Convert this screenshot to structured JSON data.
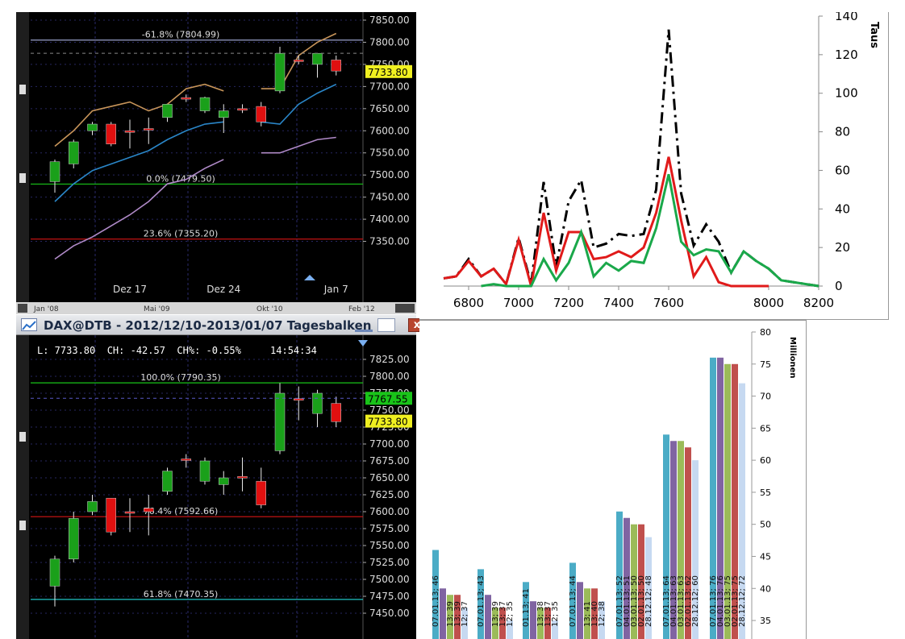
{
  "window": {
    "title": "DAX@DTB - 2012/12/10-2013/01/07 Tagesbalken",
    "close_label": "x",
    "info": {
      "last": "L: 7733.80",
      "change": "CH: -42.57",
      "change_pct": "CH%: -0.55%",
      "time": "14:54:34"
    }
  },
  "colors": {
    "up": "#1aa01a",
    "down": "#e01010",
    "bg": "#000000",
    "wick": "#e8e8e8"
  },
  "chart_data": [
    {
      "id": "dax-daily-top",
      "type": "candlestick",
      "ylim": [
        7300,
        7850
      ],
      "y_ticks": [
        7850,
        7800,
        7750,
        7700,
        7650,
        7600,
        7550,
        7500,
        7450,
        7400,
        7350
      ],
      "y_tick_labels": [
        "7850.00",
        "7800.00",
        "7750.00",
        "7700.00",
        "7650.00",
        "7600.00",
        "7550.00",
        "7500.00",
        "7450.00",
        "7400.00",
        "7350.00"
      ],
      "x_labels": [
        "Dez 17",
        "Dez 24",
        "Jan 7"
      ],
      "x_label_slots": [
        5,
        10,
        16
      ],
      "nav_labels": [
        "Jan '08",
        "Mai '09",
        "Okt '10",
        "Feb '12"
      ],
      "price_tag": "7733.80",
      "levels": [
        {
          "label": "-61.8% (7804.99)",
          "value": 7804.99,
          "color": "#9aa0c8"
        },
        {
          "label": "0.0% (7479.50)",
          "value": 7479.5,
          "color": "#19c419"
        },
        {
          "label": "23.6% (7355.20)",
          "value": 7355.2,
          "color": "#d61515"
        }
      ],
      "candles": [
        {
          "o": 7485,
          "h": 7535,
          "l": 7460,
          "c": 7530
        },
        {
          "o": 7525,
          "h": 7580,
          "l": 7515,
          "c": 7575
        },
        {
          "o": 7600,
          "h": 7620,
          "l": 7590,
          "c": 7615
        },
        {
          "o": 7615,
          "h": 7620,
          "l": 7565,
          "c": 7570
        },
        {
          "o": 7600,
          "h": 7625,
          "l": 7560,
          "c": 7600
        },
        {
          "o": 7605,
          "h": 7630,
          "l": 7570,
          "c": 7605
        },
        {
          "o": 7630,
          "h": 7655,
          "l": 7620,
          "c": 7660
        },
        {
          "o": 7675,
          "h": 7682,
          "l": 7665,
          "c": 7675
        },
        {
          "o": 7645,
          "h": 7677,
          "l": 7640,
          "c": 7675
        },
        {
          "o": 7630,
          "h": 7660,
          "l": 7595,
          "c": 7645
        },
        {
          "o": 7650,
          "h": 7660,
          "l": 7640,
          "c": 7650
        },
        {
          "o": 7655,
          "h": 7665,
          "l": 7610,
          "c": 7620
        },
        {
          "o": 7690,
          "h": 7790,
          "l": 7685,
          "c": 7775
        },
        {
          "o": 7760,
          "h": 7770,
          "l": 7750,
          "c": 7760
        },
        {
          "o": 7750,
          "h": 7775,
          "l": 7720,
          "c": 7775
        },
        {
          "o": 7760,
          "h": 7770,
          "l": 7725,
          "c": 7735
        }
      ],
      "bands": [
        {
          "name": "upper",
          "color": "#c8955a",
          "values": [
            7565,
            7600,
            7645,
            7655,
            7665,
            7645,
            7660,
            7695,
            7705,
            7690,
            null,
            7695,
            7695,
            7770,
            7800,
            7820
          ]
        },
        {
          "name": "middle",
          "color": "#2a86c8",
          "values": [
            7440,
            7480,
            7510,
            7525,
            7540,
            7555,
            7580,
            7600,
            7615,
            7620,
            null,
            7620,
            7615,
            7660,
            7685,
            7705
          ]
        },
        {
          "name": "lower",
          "color": "#b08ac8",
          "values": [
            7310,
            7340,
            7360,
            7385,
            7410,
            7440,
            7480,
            7490,
            7515,
            7535,
            null,
            7550,
            7550,
            7565,
            7580,
            7585
          ]
        }
      ]
    },
    {
      "id": "dax-daily-bottom",
      "type": "candlestick",
      "ylim": [
        7450,
        7825
      ],
      "y_ticks": [
        7825,
        7800,
        7775,
        7750,
        7725,
        7700,
        7675,
        7650,
        7625,
        7600,
        7575,
        7550,
        7525,
        7500,
        7475,
        7450
      ],
      "y_tick_labels": [
        "7825.00",
        "7800.00",
        "7775.00",
        "7750.00",
        "7725.00",
        "7700.00",
        "7675.00",
        "7650.00",
        "7625.00",
        "7600.00",
        "7575.00",
        "7550.00",
        "7525.00",
        "7500.00",
        "7475.00",
        "7450.00"
      ],
      "price_tags": [
        {
          "label": "7767.55",
          "value": 7767.55,
          "bg": "#19c419"
        },
        {
          "label": "7733.80",
          "value": 7733.8,
          "bg": "#f0f020"
        }
      ],
      "levels": [
        {
          "label": "100.0% (7790.35)",
          "value": 7790.35,
          "color": "#19c419"
        },
        {
          "label": "76.4% (7592.66)",
          "value": 7592.66,
          "color": "#d61515"
        },
        {
          "label": "61.8% (7470.35)",
          "value": 7470.35,
          "color": "#1fc4c4"
        }
      ],
      "candles": [
        {
          "o": 7490,
          "h": 7535,
          "l": 7460,
          "c": 7530
        },
        {
          "o": 7530,
          "h": 7600,
          "l": 7525,
          "c": 7590
        },
        {
          "o": 7600,
          "h": 7625,
          "l": 7595,
          "c": 7615
        },
        {
          "o": 7620,
          "h": 7620,
          "l": 7565,
          "c": 7570
        },
        {
          "o": 7600,
          "h": 7620,
          "l": 7570,
          "c": 7600
        },
        {
          "o": 7605,
          "h": 7625,
          "l": 7565,
          "c": 7600
        },
        {
          "o": 7630,
          "h": 7665,
          "l": 7625,
          "c": 7660
        },
        {
          "o": 7678,
          "h": 7685,
          "l": 7665,
          "c": 7678
        },
        {
          "o": 7645,
          "h": 7680,
          "l": 7640,
          "c": 7675
        },
        {
          "o": 7640,
          "h": 7660,
          "l": 7625,
          "c": 7650
        },
        {
          "o": 7652,
          "h": 7680,
          "l": 7630,
          "c": 7652
        },
        {
          "o": 7645,
          "h": 7665,
          "l": 7605,
          "c": 7610
        },
        {
          "o": 7690,
          "h": 7790,
          "l": 7685,
          "c": 7775
        },
        {
          "o": 7767,
          "h": 7785,
          "l": 7735,
          "c": 7767
        },
        {
          "o": 7745,
          "h": 7780,
          "l": 7725,
          "c": 7775
        },
        {
          "o": 7760,
          "h": 7770,
          "l": 7725,
          "c": 7733
        }
      ]
    },
    {
      "id": "distribution-line",
      "type": "line",
      "xlim": [
        6700,
        8200
      ],
      "ylim": [
        0,
        140
      ],
      "x_ticks": [
        6800,
        7000,
        7200,
        7400,
        7600,
        8000,
        8200
      ],
      "y_ticks": [
        0,
        20,
        40,
        60,
        80,
        100,
        120,
        140
      ],
      "ylabel": "Taus",
      "x": [
        6700,
        6750,
        6800,
        6850,
        6900,
        6950,
        7000,
        7050,
        7100,
        7150,
        7200,
        7250,
        7300,
        7350,
        7400,
        7450,
        7500,
        7550,
        7600,
        7650,
        7700,
        7750,
        7800,
        7850,
        7900,
        7950,
        8000,
        8050,
        8100,
        8150,
        8200
      ],
      "series": [
        {
          "style": "dashdot",
          "color": "#000000",
          "values": [
            4,
            5,
            14,
            5,
            9,
            1,
            25,
            1,
            54,
            10,
            44,
            55,
            20,
            22,
            27,
            26,
            27,
            50,
            133,
            48,
            21,
            32,
            23,
            7,
            18,
            13,
            9,
            3,
            2,
            1,
            0
          ]
        },
        {
          "style": "solid",
          "color": "#e01a1a",
          "values": [
            4,
            5,
            13,
            5,
            9,
            1,
            24,
            0,
            38,
            8,
            28,
            28,
            14,
            15,
            18,
            15,
            20,
            38,
            67,
            34,
            5,
            15,
            2,
            0,
            0,
            0,
            0,
            null,
            null,
            null,
            null
          ]
        },
        {
          "style": "solid",
          "color": "#1aa84a",
          "values": [
            null,
            null,
            null,
            0,
            1,
            0,
            0,
            0,
            14,
            3,
            12,
            28,
            5,
            12,
            8,
            13,
            12,
            30,
            58,
            23,
            16,
            19,
            18,
            7,
            18,
            13,
            9,
            3,
            2,
            1,
            0
          ]
        }
      ]
    },
    {
      "id": "grouped-bars",
      "type": "bar",
      "ylim": [
        34,
        80
      ],
      "y_ticks": [
        80,
        75,
        70,
        65,
        60,
        55,
        50,
        45,
        40,
        35
      ],
      "ylabel": "Millionen",
      "series_colors": [
        "#4bacc6",
        "#8064a2",
        "#9bbb59",
        "#c0504d",
        "#c6d9f1"
      ],
      "groups": [
        {
          "values": [
            46,
            40,
            39,
            39,
            37
          ],
          "labels": [
            "07.01.13; 46",
            "",
            "13; 39",
            "13; 39",
            "12; 37"
          ]
        },
        {
          "values": [
            43,
            39,
            37,
            37,
            35
          ],
          "labels": [
            "07.01.13; 43",
            "",
            "13; 39",
            "13; 37",
            "12; 35"
          ]
        },
        {
          "values": [
            41,
            38,
            37,
            37,
            35
          ],
          "labels": [
            "01.13; 41",
            "",
            "13; 38",
            "13; 37",
            "12; 35"
          ]
        },
        {
          "values": [
            44,
            41,
            40,
            40,
            38
          ],
          "labels": [
            "07.01.13; 44",
            "",
            "13; 41",
            "13; 40",
            "12; 38"
          ]
        },
        {
          "values": [
            52,
            51,
            50,
            50,
            48
          ],
          "labels": [
            "07.01.13; 52",
            "04.01.13; 51",
            "03.01.13; 50",
            "02.01.13; 50",
            "28.12.12; 48"
          ]
        },
        {
          "values": [
            64,
            63,
            63,
            62,
            60
          ],
          "labels": [
            "07.01.13; 64",
            "04.01.13; 63",
            "03.01.13; 63",
            "02.01.13; 62",
            "28.12.12; 60"
          ]
        },
        {
          "values": [
            76,
            76,
            75,
            75,
            72
          ],
          "labels": [
            "07.01.13; 76",
            "04.01.13; 76",
            "03.01.13; 75",
            "02.01.13; 75",
            "28.12.12; 72"
          ]
        }
      ]
    }
  ]
}
